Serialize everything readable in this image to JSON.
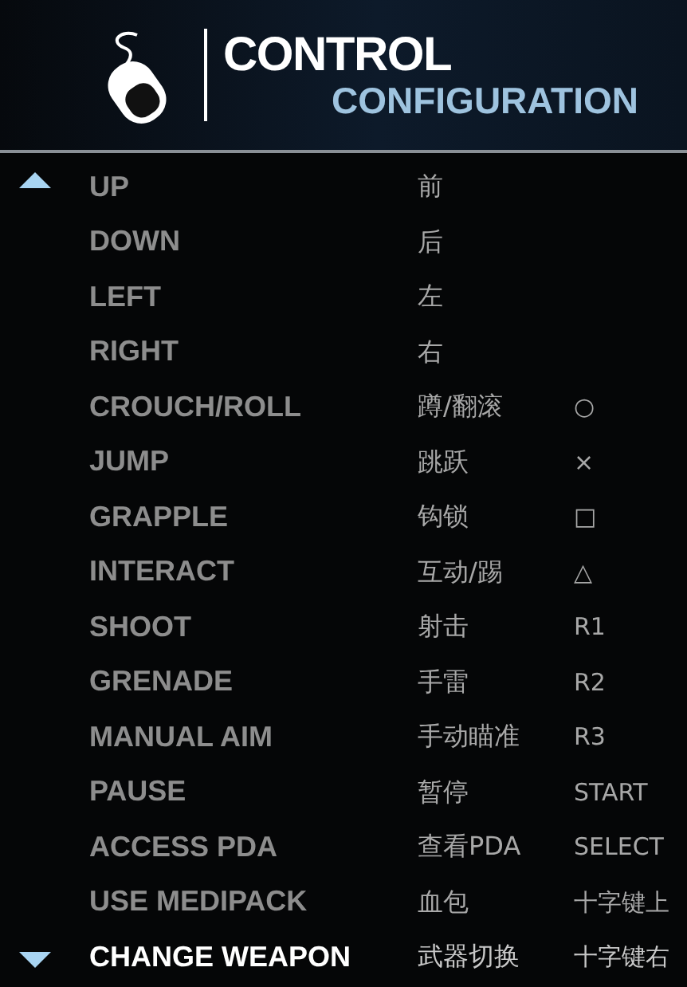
{
  "header": {
    "title": "CONTROL",
    "subtitle": "CONFIGURATION"
  },
  "bindings": [
    {
      "action": "UP",
      "label_cn": "前",
      "selected": false
    },
    {
      "action": "DOWN",
      "label_cn": "后",
      "selected": false
    },
    {
      "action": "LEFT",
      "label_cn": "左",
      "selected": false
    },
    {
      "action": "RIGHT",
      "label_cn": "右",
      "selected": false
    },
    {
      "action": "CROUCH/ROLL",
      "label_cn": "蹲/翻滚",
      "key": "○",
      "selected": false
    },
    {
      "action": "JUMP",
      "label_cn": "跳跃",
      "key": "×",
      "selected": false
    },
    {
      "action": "GRAPPLE",
      "label_cn": "钩锁",
      "key": "□",
      "selected": false
    },
    {
      "action": "INTERACT",
      "label_cn": "互动/踢",
      "key": "△",
      "selected": false
    },
    {
      "action": "SHOOT",
      "label_cn": "射击",
      "key": "R1",
      "selected": false
    },
    {
      "action": "GRENADE",
      "label_cn": "手雷",
      "key": "R2",
      "selected": false
    },
    {
      "action": "MANUAL AIM",
      "label_cn": "手动瞄准",
      "key": "R3",
      "selected": false
    },
    {
      "action": "PAUSE",
      "label_cn": "暂停",
      "key": "START",
      "selected": false
    },
    {
      "action": "ACCESS PDA",
      "label_cn": "查看PDA",
      "key": "SELECT",
      "selected": false
    },
    {
      "action": "USE MEDIPACK",
      "label_cn": "血包",
      "key": "十字键上",
      "selected": false
    },
    {
      "action": "CHANGE WEAPON",
      "label_cn": "武器切换",
      "key": "十字键右",
      "selected": true
    }
  ]
}
